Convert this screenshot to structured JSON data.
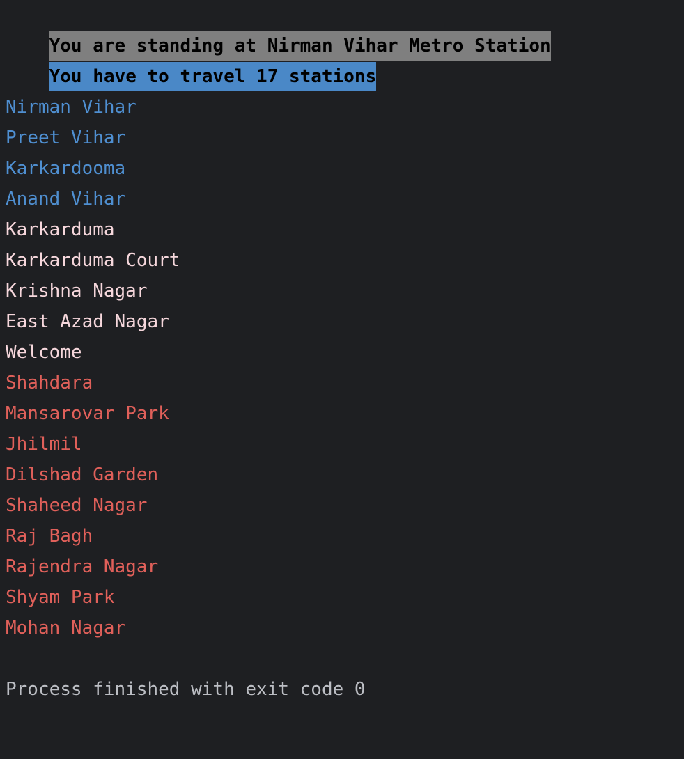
{
  "console": {
    "header": [
      {
        "text": "You are standing at Nirman Vihar Metro Station",
        "bg": "#7f7f7f"
      },
      {
        "text": "You have to travel 17 stations",
        "bg": "#4a88c7"
      }
    ],
    "groups": [
      {
        "color": "#4f8fd1",
        "stations": [
          "Nirman Vihar",
          "Preet Vihar",
          "Karkardooma",
          "Anand Vihar"
        ]
      },
      {
        "color": "#f6d7dc",
        "stations": [
          "Karkarduma",
          "Karkarduma Court",
          "Krishna Nagar",
          "East Azad Nagar",
          "Welcome"
        ]
      },
      {
        "color": "#e0605a",
        "stations": [
          "Shahdara",
          "Mansarovar Park",
          "Jhilmil",
          "Dilshad Garden",
          "Shaheed Nagar",
          "Raj Bagh",
          "Rajendra Nagar",
          "Shyam Park",
          "Mohan Nagar"
        ]
      }
    ],
    "footer": {
      "text": "Process finished with exit code 0",
      "color": "#bcbec4"
    }
  },
  "colors": {
    "background": "#1e1f22"
  }
}
